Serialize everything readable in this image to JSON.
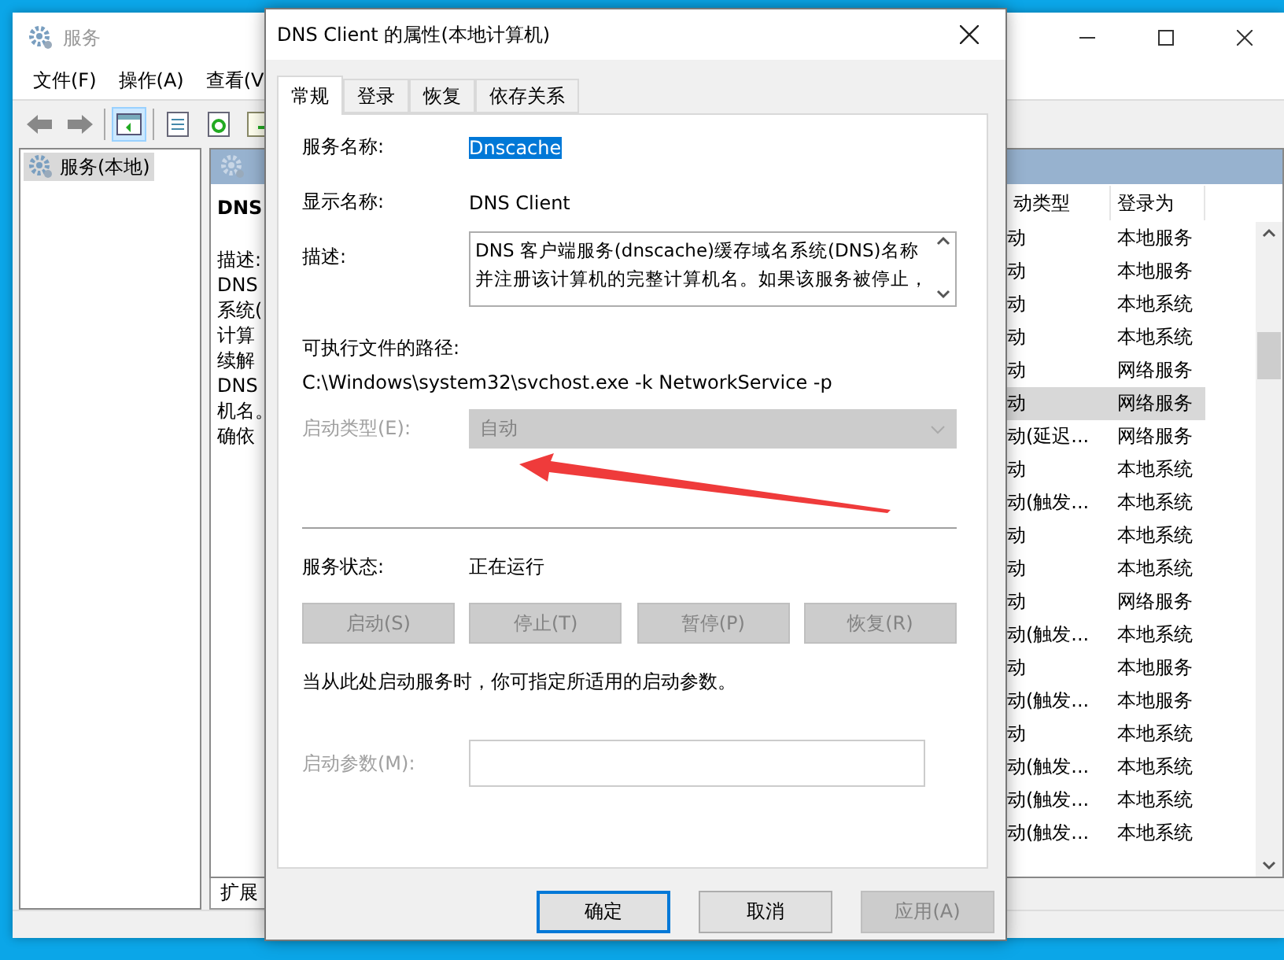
{
  "services_window": {
    "title": "服务",
    "menu": [
      "文件(F)",
      "操作(A)",
      "查看(V"
    ],
    "tree": [
      {
        "label": "服务(本地)",
        "selected": true
      }
    ],
    "detail": {
      "heading": "DNS",
      "lines": [
        "描述:",
        "DNS",
        "系统(",
        "计算",
        "续解",
        "DNS",
        "机名。",
        "确依"
      ]
    },
    "columns": [
      "动类型",
      "登录为"
    ],
    "rows": [
      {
        "startup": "动",
        "logon": "本地服务",
        "selected": false
      },
      {
        "startup": "动",
        "logon": "本地服务",
        "selected": false
      },
      {
        "startup": "动",
        "logon": "本地系统",
        "selected": false
      },
      {
        "startup": "动",
        "logon": "本地系统",
        "selected": false
      },
      {
        "startup": "动",
        "logon": "网络服务",
        "selected": false
      },
      {
        "startup": "动",
        "logon": "网络服务",
        "selected": true
      },
      {
        "startup": "动(延迟...",
        "logon": "网络服务",
        "selected": false
      },
      {
        "startup": "动",
        "logon": "本地系统",
        "selected": false
      },
      {
        "startup": "动(触发...",
        "logon": "本地系统",
        "selected": false
      },
      {
        "startup": "动",
        "logon": "本地系统",
        "selected": false
      },
      {
        "startup": "动",
        "logon": "本地系统",
        "selected": false
      },
      {
        "startup": "动",
        "logon": "网络服务",
        "selected": false
      },
      {
        "startup": "动(触发...",
        "logon": "本地系统",
        "selected": false
      },
      {
        "startup": "动",
        "logon": "本地服务",
        "selected": false
      },
      {
        "startup": "动(触发...",
        "logon": "本地服务",
        "selected": false
      },
      {
        "startup": "动",
        "logon": "本地系统",
        "selected": false
      },
      {
        "startup": "动(触发...",
        "logon": "本地系统",
        "selected": false
      },
      {
        "startup": "动(触发...",
        "logon": "本地系统",
        "selected": false
      },
      {
        "startup": "动(触发...",
        "logon": "本地系统",
        "selected": false
      }
    ],
    "bottom_tab": "扩展"
  },
  "dialog": {
    "title": "DNS Client 的属性(本地计算机)",
    "tabs": [
      {
        "label": "常规",
        "selected": true
      },
      {
        "label": "登录",
        "selected": false
      },
      {
        "label": "恢复",
        "selected": false
      },
      {
        "label": "依存关系",
        "selected": false
      }
    ],
    "service_name": {
      "label": "服务名称:",
      "value": "Dnscache",
      "highlighted": true
    },
    "display_name": {
      "label": "显示名称:",
      "value": "DNS Client"
    },
    "description": {
      "label": "描述:",
      "lines": [
        "DNS 客户端服务(dnscache)缓存域名系统(DNS)名称",
        "并注册该计算机的完整计算机名。如果该服务被停止，"
      ]
    },
    "path": {
      "label": "可执行文件的路径:",
      "value": "C:\\Windows\\system32\\svchost.exe -k NetworkService -p"
    },
    "startup_type": {
      "label": "启动类型(E):",
      "value": "自动",
      "disabled": true
    },
    "status": {
      "label": "服务状态:",
      "value": "正在运行"
    },
    "service_buttons": [
      {
        "label": "启动(S)",
        "disabled": true
      },
      {
        "label": "停止(T)",
        "disabled": true
      },
      {
        "label": "暂停(P)",
        "disabled": true
      },
      {
        "label": "恢复(R)",
        "disabled": true
      }
    ],
    "note": "当从此处启动服务时，你可指定所适用的启动参数。",
    "start_params": {
      "label": "启动参数(M):",
      "disabled": true
    },
    "buttons": [
      {
        "label": "确定",
        "default": true,
        "disabled": false
      },
      {
        "label": "取消",
        "default": false,
        "disabled": false
      },
      {
        "label": "应用(A)",
        "default": false,
        "disabled": true
      }
    ]
  }
}
